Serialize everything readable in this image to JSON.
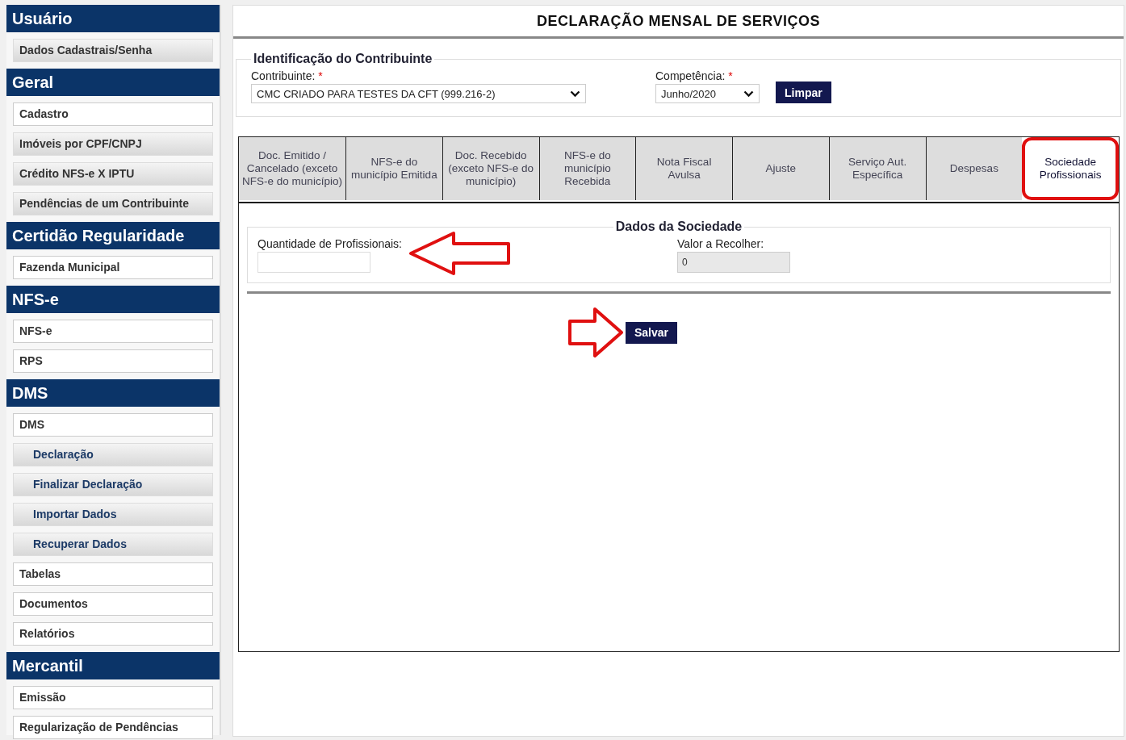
{
  "sidebar": {
    "sections": [
      {
        "title": "Usuário",
        "items": [
          {
            "label": "Dados Cadastrais/Senha",
            "kind": "shaded"
          }
        ]
      },
      {
        "title": "Geral",
        "items": [
          {
            "label": "Cadastro",
            "kind": "plain"
          },
          {
            "label": "Imóveis por CPF/CNPJ",
            "kind": "shaded"
          },
          {
            "label": "Crédito NFS-e X IPTU",
            "kind": "shaded"
          },
          {
            "label": "Pendências de um Contribuinte",
            "kind": "shaded"
          }
        ]
      },
      {
        "title": "Certidão Regularidade",
        "items": [
          {
            "label": "Fazenda Municipal",
            "kind": "plain"
          }
        ]
      },
      {
        "title": "NFS-e",
        "items": [
          {
            "label": "NFS-e",
            "kind": "plain"
          },
          {
            "label": "RPS",
            "kind": "plain"
          }
        ]
      },
      {
        "title": "DMS",
        "items": [
          {
            "label": "DMS",
            "kind": "plain"
          },
          {
            "label": "Declaração",
            "kind": "sub"
          },
          {
            "label": "Finalizar Declaração",
            "kind": "sub"
          },
          {
            "label": "Importar Dados",
            "kind": "sub"
          },
          {
            "label": "Recuperar Dados",
            "kind": "sub"
          },
          {
            "label": "Tabelas",
            "kind": "plain"
          },
          {
            "label": "Documentos",
            "kind": "plain"
          },
          {
            "label": "Relatórios",
            "kind": "plain"
          }
        ]
      },
      {
        "title": "Mercantil",
        "items": [
          {
            "label": "Emissão",
            "kind": "plain"
          },
          {
            "label": "Regularização de Pendências",
            "kind": "plain"
          }
        ]
      }
    ]
  },
  "page_title": "DECLARAÇÃO MENSAL DE SERVIÇOS",
  "identification": {
    "legend": "Identificação do Contribuinte",
    "contribuinte": {
      "label": "Contribuinte:",
      "required_mark": "*",
      "value": "CMC CRIADO PARA TESTES DA CFT (999.216-2)"
    },
    "competencia": {
      "label": "Competência:",
      "required_mark": "*",
      "value": "Junho/2020"
    },
    "clear_button": "Limpar"
  },
  "tabs": [
    {
      "label": "Doc. Emitido / Cancelado (exceto NFS-e do município)",
      "selected": false,
      "highlighted": false
    },
    {
      "label": "NFS-e do município Emitida",
      "selected": false,
      "highlighted": false
    },
    {
      "label": "Doc. Recebido (exceto NFS-e do município)",
      "selected": false,
      "highlighted": false
    },
    {
      "label": "NFS-e do município Recebida",
      "selected": false,
      "highlighted": false
    },
    {
      "label": "Nota Fiscal Avulsa",
      "selected": false,
      "highlighted": false
    },
    {
      "label": "Ajuste",
      "selected": false,
      "highlighted": false
    },
    {
      "label": "Serviço Aut. Específica",
      "selected": false,
      "highlighted": false
    },
    {
      "label": "Despesas",
      "selected": false,
      "highlighted": false
    },
    {
      "label": "Sociedade Profissionais",
      "selected": true,
      "highlighted": true
    }
  ],
  "society": {
    "legend": "Dados da Sociedade",
    "quantity": {
      "label": "Quantidade de Profissionais:",
      "pointer_arrow": true
    },
    "amount": {
      "label": "Valor a Recolher:",
      "value": "0",
      "disabled": true
    }
  },
  "save_button": {
    "label": "Salvar",
    "pointer_arrow": true
  }
}
